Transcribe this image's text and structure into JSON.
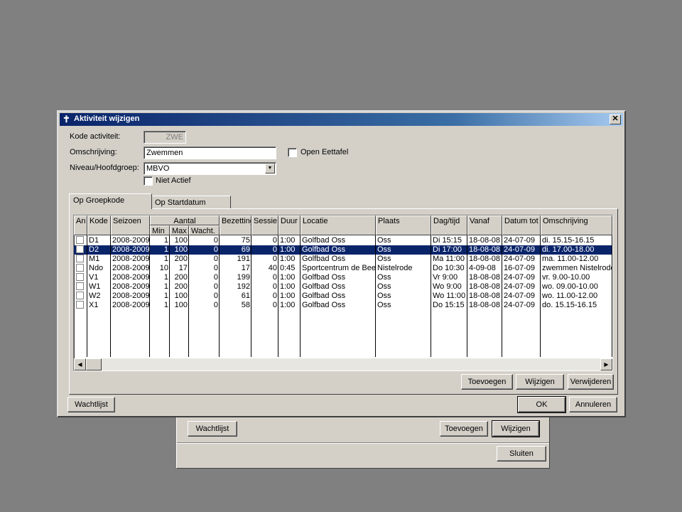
{
  "background_window": {
    "wachtlijst_label": "Wachtlijst",
    "toevoegen_label": "Toevoegen",
    "wijzigen_label": "Wijzigen",
    "sluiten_label": "Sluiten"
  },
  "dialog": {
    "title": "Aktiviteit wijzigen",
    "close_label": "✕",
    "kode_label": "Kode activiteit:",
    "kode_value": "ZWE",
    "omschrijving_label": "Omschrijving:",
    "omschrijving_value": "Zwemmen",
    "open_eettafel_label": "Open Eettafel",
    "niveau_label": "Niveau/Hoofdgroep:",
    "niveau_value": "MBVO",
    "niet_actief_label": "Niet Actief",
    "tabs": [
      {
        "label": "Op Groepkode"
      },
      {
        "label": "Op Startdatum"
      }
    ],
    "grid": {
      "headers": {
        "an": "An",
        "kode": "Kode",
        "seizoen": "Seizoen",
        "aantal": "Aantal",
        "min": "Min",
        "max": "Max",
        "wacht": "Wacht.",
        "bezetting": "Bezetting",
        "sessie": "Sessie",
        "duur": "Duur",
        "locatie": "Locatie",
        "plaats": "Plaats",
        "dagtijd": "Dag/tijd",
        "vanaf": "Vanaf",
        "datumtot": "Datum tot",
        "omschrijving": "Omschrijving"
      },
      "rows": [
        {
          "kode": "D1",
          "seizoen": "2008-2009",
          "min": "1",
          "max": "100",
          "wacht": "0",
          "bez": "75",
          "sessie": "0",
          "duur": "1:00",
          "locatie": "Golfbad Oss",
          "plaats": "Oss",
          "dag": "Di 15:15",
          "vanaf": "18-08-08",
          "tot": "24-07-09",
          "oms": "di. 15.15-16.15"
        },
        {
          "kode": "D2",
          "seizoen": "2008-2009",
          "min": "1",
          "max": "100",
          "wacht": "0",
          "bez": "69",
          "sessie": "0",
          "duur": "1:00",
          "locatie": "Golfbad Oss",
          "plaats": "Oss",
          "dag": "Di 17:00",
          "vanaf": "18-08-08",
          "tot": "24-07-09",
          "oms": "di. 17.00-18.00"
        },
        {
          "kode": "M1",
          "seizoen": "2008-2009",
          "min": "1",
          "max": "200",
          "wacht": "0",
          "bez": "191",
          "sessie": "0",
          "duur": "1:00",
          "locatie": "Golfbad Oss",
          "plaats": "Oss",
          "dag": "Ma 11:00",
          "vanaf": "18-08-08",
          "tot": "24-07-09",
          "oms": "ma. 11.00-12.00"
        },
        {
          "kode": "Ndo",
          "seizoen": "2008-2009",
          "min": "10",
          "max": "17",
          "wacht": "0",
          "bez": "17",
          "sessie": "40",
          "duur": "0:45",
          "locatie": "Sportcentrum de Beek",
          "plaats": "Nistelrode",
          "dag": "Do 10:30",
          "vanaf": "4-09-08",
          "tot": "16-07-09",
          "oms": "zwemmen Nistelrode"
        },
        {
          "kode": "V1",
          "seizoen": "2008-2009",
          "min": "1",
          "max": "200",
          "wacht": "0",
          "bez": "199",
          "sessie": "0",
          "duur": "1:00",
          "locatie": "Golfbad Oss",
          "plaats": "Oss",
          "dag": "Vr  9:00",
          "vanaf": "18-08-08",
          "tot": "24-07-09",
          "oms": "vr. 9.00-10.00"
        },
        {
          "kode": "W1",
          "seizoen": "2008-2009",
          "min": "1",
          "max": "200",
          "wacht": "0",
          "bez": "192",
          "sessie": "0",
          "duur": "1:00",
          "locatie": "Golfbad Oss",
          "plaats": "Oss",
          "dag": "Wo  9:00",
          "vanaf": "18-08-08",
          "tot": "24-07-09",
          "oms": "wo. 09.00-10.00"
        },
        {
          "kode": "W2",
          "seizoen": "2008-2009",
          "min": "1",
          "max": "100",
          "wacht": "0",
          "bez": "61",
          "sessie": "0",
          "duur": "1:00",
          "locatie": "Golfbad Oss",
          "plaats": "Oss",
          "dag": "Wo 11:00",
          "vanaf": "18-08-08",
          "tot": "24-07-09",
          "oms": "wo. 11.00-12.00"
        },
        {
          "kode": "X1",
          "seizoen": "2008-2009",
          "min": "1",
          "max": "100",
          "wacht": "0",
          "bez": "58",
          "sessie": "0",
          "duur": "1:00",
          "locatie": "Golfbad Oss",
          "plaats": "Oss",
          "dag": "Do 15:15",
          "vanaf": "18-08-08",
          "tot": "24-07-09",
          "oms": "do. 15.15-16.15"
        }
      ]
    },
    "toevoegen_label": "Toevoegen",
    "wijzigen_label": "Wijzigen",
    "verwijderen_label": "Verwijderen",
    "wachtlijst_label": "Wachtlijst",
    "ok_label": "OK",
    "annuleren_label": "Annuleren"
  }
}
